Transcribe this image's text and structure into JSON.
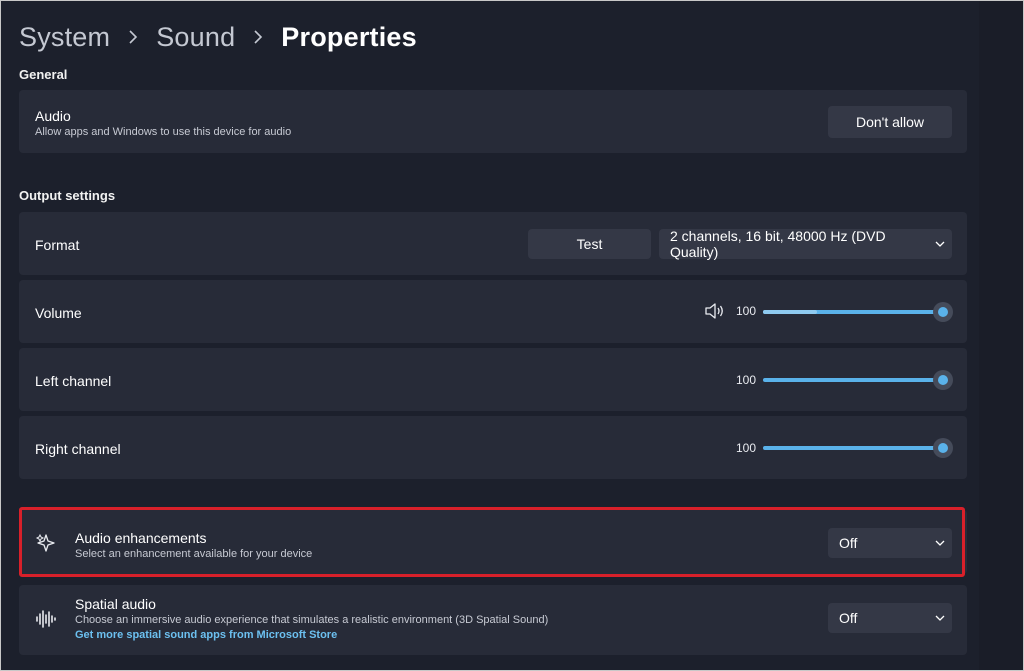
{
  "breadcrumb": {
    "items": [
      "System",
      "Sound",
      "Properties"
    ]
  },
  "general": {
    "section_title": "General",
    "audio_title": "Audio",
    "audio_sub": "Allow apps and Windows to use this device for audio",
    "dont_allow_label": "Don't allow"
  },
  "output": {
    "section_title": "Output settings",
    "format_label": "Format",
    "test_label": "Test",
    "format_value": "2 channels, 16 bit, 48000 Hz (DVD Quality)",
    "volume_label": "Volume",
    "volume_value": "100",
    "left_label": "Left channel",
    "left_value": "100",
    "right_label": "Right channel",
    "right_value": "100"
  },
  "enhancements": {
    "title": "Audio enhancements",
    "sub": "Select an enhancement available for your device",
    "value": "Off"
  },
  "spatial": {
    "title": "Spatial audio",
    "sub": "Choose an immersive audio experience that simulates a realistic environment (3D Spatial Sound)",
    "link": "Get more spatial sound apps from Microsoft Store",
    "value": "Off"
  },
  "colors": {
    "accent": "#5ab2ea",
    "highlight_border": "#d8202a",
    "card_bg": "#272b38",
    "page_bg": "#1c202c"
  },
  "icons": {
    "speaker": "speaker-icon",
    "enhance": "sparkle-icon",
    "spatial": "waveform-icon",
    "chevron": "chevron-down-icon",
    "breadcrumb_sep": "chevron-right-icon"
  }
}
